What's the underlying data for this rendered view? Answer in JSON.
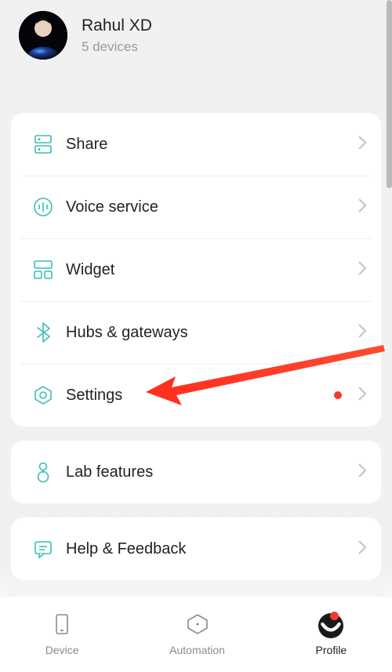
{
  "profile": {
    "name": "Rahul XD",
    "subtitle": "5 devices"
  },
  "menu": {
    "share": {
      "label": "Share",
      "icon": "share-icon"
    },
    "voice": {
      "label": "Voice service",
      "icon": "voice-icon"
    },
    "widget": {
      "label": "Widget",
      "icon": "widget-icon"
    },
    "hubs": {
      "label": "Hubs & gateways",
      "icon": "bluetooth-icon"
    },
    "settings": {
      "label": "Settings",
      "icon": "settings-icon",
      "has_dot": true
    },
    "lab": {
      "label": "Lab features",
      "icon": "lab-icon"
    },
    "help": {
      "label": "Help & Feedback",
      "icon": "feedback-icon"
    }
  },
  "nav": {
    "device": {
      "label": "Device"
    },
    "automation": {
      "label": "Automation"
    },
    "profile": {
      "label": "Profile",
      "active": true,
      "has_badge": true
    }
  },
  "annotation": {
    "arrow_target": "settings-row"
  }
}
